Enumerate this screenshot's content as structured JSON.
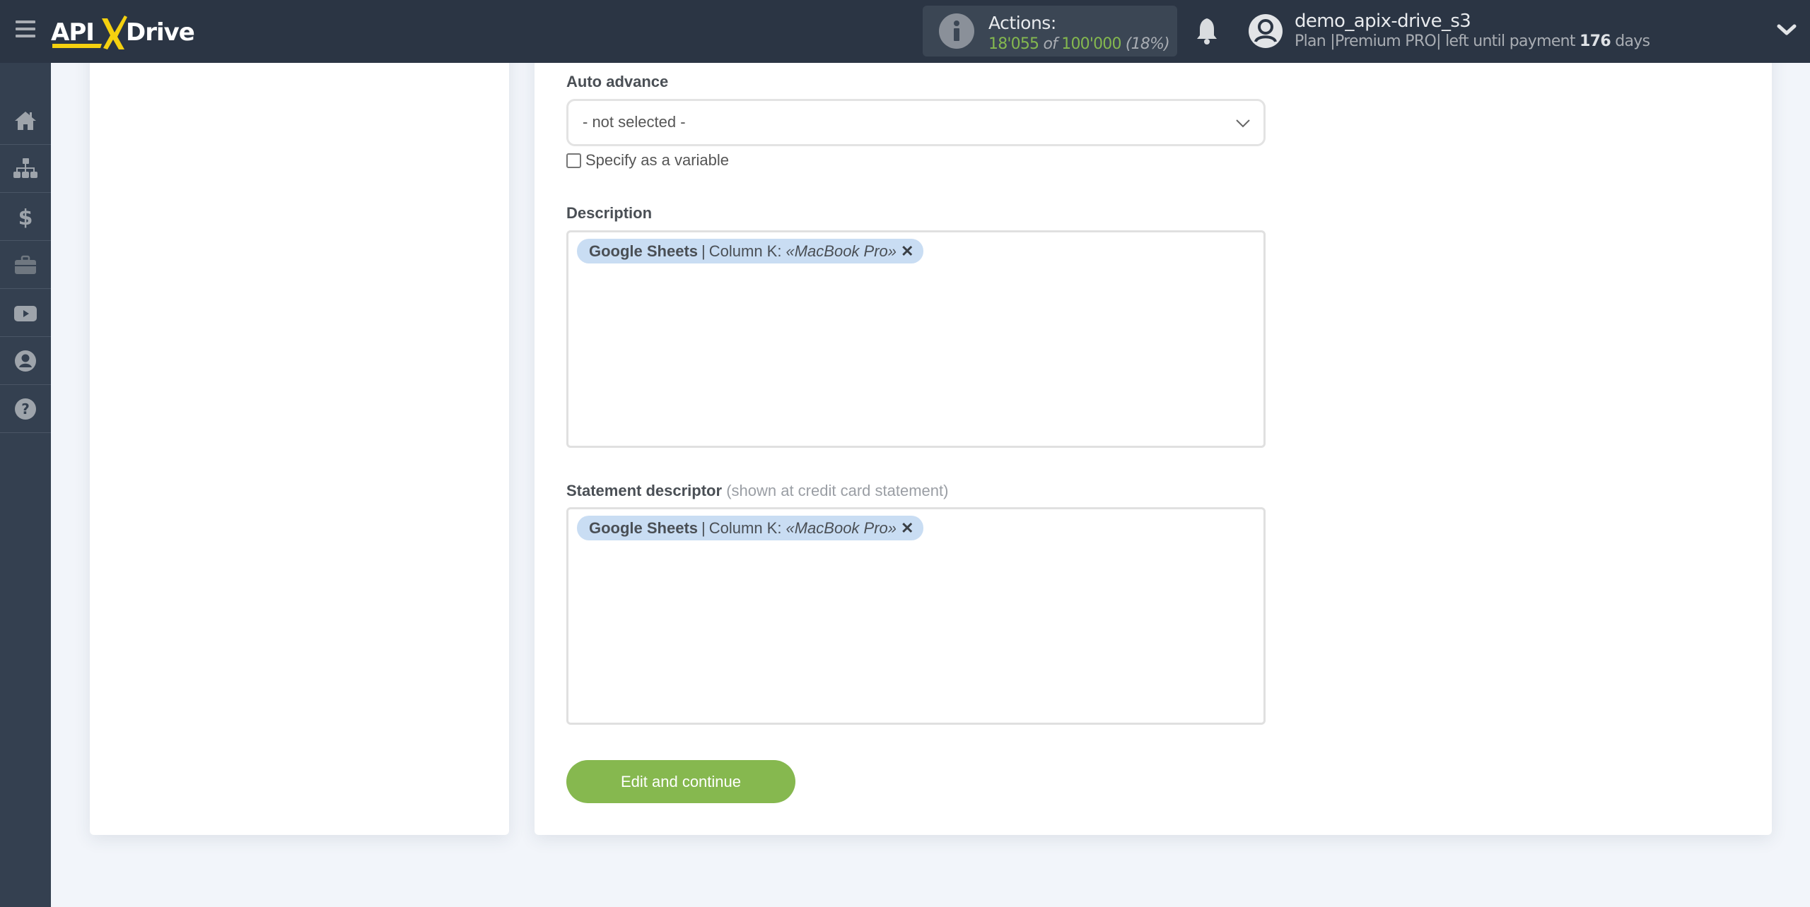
{
  "header": {
    "logo_text": "APIXDrive",
    "actions": {
      "title": "Actions:",
      "used": "18'055",
      "of": "of",
      "total": "100'000",
      "percent": "(18%)"
    },
    "user": {
      "name": "demo_apix-drive_s3",
      "plan_prefix": "Plan |Premium PRO| left until payment",
      "days": "176",
      "days_suffix": "days"
    }
  },
  "sidebar": {
    "items": [
      {
        "icon": "home-icon",
        "label": "Home"
      },
      {
        "icon": "sitemap-icon",
        "label": "Connections"
      },
      {
        "icon": "dollar-icon",
        "label": "Billing"
      },
      {
        "icon": "briefcase-icon",
        "label": "Projects"
      },
      {
        "icon": "youtube-icon",
        "label": "Video"
      },
      {
        "icon": "user-icon",
        "label": "Profile"
      },
      {
        "icon": "question-icon",
        "label": "Help"
      }
    ]
  },
  "form": {
    "auto_advance": {
      "label": "Auto advance",
      "value": "- not selected -",
      "specify_variable_label": "Specify as a variable",
      "specify_variable_checked": false
    },
    "description": {
      "label": "Description",
      "tag": {
        "source": "Google Sheets",
        "separator": "|",
        "field": "Column K:",
        "value": "«MacBook Pro»",
        "remove": "✕"
      }
    },
    "statement_descriptor": {
      "label": "Statement descriptor",
      "hint": "(shown at credit card statement)",
      "tag": {
        "source": "Google Sheets",
        "separator": "|",
        "field": "Column K:",
        "value": "«MacBook Pro»",
        "remove": "✕"
      }
    },
    "submit_label": "Edit and continue"
  },
  "colors": {
    "header_bg": "#2b3544",
    "sidebar_bg": "#344050",
    "accent_green": "#86b84f",
    "logo_yellow": "#f5d10f",
    "tag_bg": "#c9ddf3"
  }
}
